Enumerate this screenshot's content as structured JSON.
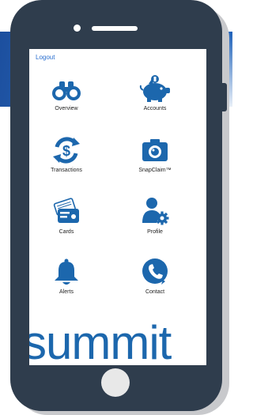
{
  "header": {
    "logout_label": "Logout"
  },
  "menu": [
    {
      "label": "Overview",
      "icon": "binoculars-icon"
    },
    {
      "label": "Accounts",
      "icon": "piggy-bank-icon"
    },
    {
      "label": "Transactions",
      "icon": "dollar-cycle-icon"
    },
    {
      "label": "SnapClaim™",
      "icon": "camera-icon"
    },
    {
      "label": "Cards",
      "icon": "credit-card-icon"
    },
    {
      "label": "Profile",
      "icon": "user-gear-icon"
    },
    {
      "label": "Alerts",
      "icon": "bell-icon"
    },
    {
      "label": "Contact",
      "icon": "phone-icon"
    }
  ],
  "brand": {
    "name": "summit"
  },
  "colors": {
    "accent": "#1c67ad",
    "link": "#2b6fcf",
    "phone": "#2f3d4d"
  }
}
